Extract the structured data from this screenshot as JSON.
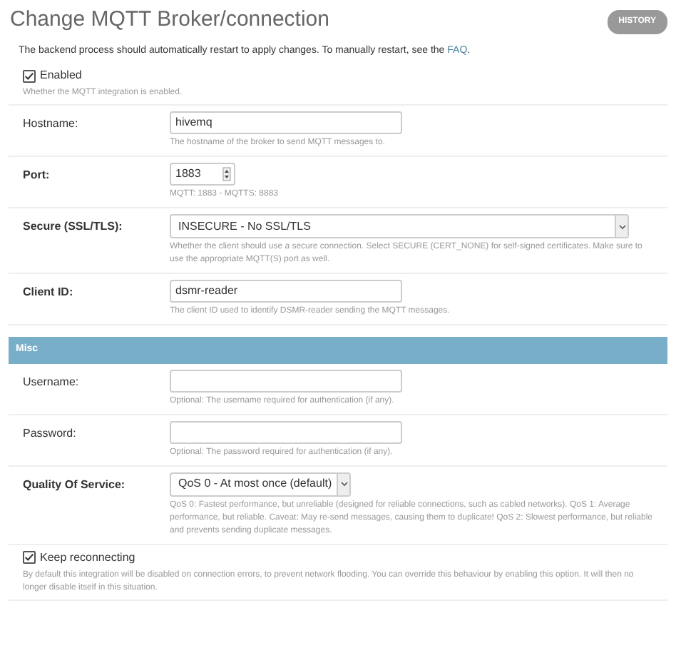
{
  "title": "Change MQTT Broker/connection",
  "history_button": "HISTORY",
  "intro": {
    "text": "The backend process should automatically restart to apply changes. To manually restart, see the",
    "link": "FAQ",
    "after": "."
  },
  "fieldsets": [
    {
      "fields": [
        {
          "kind": "checkbox",
          "label": "Enabled",
          "checked": true,
          "help": "Whether the MQTT integration is enabled."
        },
        {
          "kind": "text",
          "label": "Hostname:",
          "required": false,
          "value": "hivemq",
          "help": "The hostname of the broker to send MQTT messages to."
        },
        {
          "kind": "number",
          "label": "Port:",
          "required": true,
          "value": "1883",
          "help": "MQTT: 1883 - MQTTS: 8883"
        },
        {
          "kind": "select",
          "label": "Secure (SSL/TLS):",
          "required": true,
          "value": "INSECURE - No SSL/TLS",
          "wide": true,
          "help": "Whether the client should use a secure connection. Select SECURE (CERT_NONE) for self-signed certificates. Make sure to use the appropriate MQTT(S) port as well."
        },
        {
          "kind": "text",
          "label": "Client ID:",
          "required": true,
          "value": "dsmr-reader",
          "help": "The client ID used to identify DSMR-reader sending the MQTT messages."
        }
      ]
    },
    {
      "heading": "Misc",
      "fields": [
        {
          "kind": "text",
          "label": "Username:",
          "required": false,
          "help": "Optional: The username required for authentication (if any)."
        },
        {
          "kind": "text",
          "label": "Password:",
          "required": false,
          "help": "Optional: The password required for authentication (if any)."
        },
        {
          "kind": "select",
          "label": "Quality Of Service:",
          "required": true,
          "value": "QoS 0 - At most once (default)",
          "wide": false,
          "help": "QoS 0: Fastest performance, but unreliable (designed for reliable connections, such as cabled networks). QoS 1: Average performance, but reliable. Caveat: May re-send messages, causing them to duplicate! QoS 2: Slowest performance, but reliable and prevents sending duplicate messages."
        },
        {
          "kind": "checkbox",
          "label": "Keep reconnecting",
          "checked": true,
          "help": "By default this integration will be disabled on connection errors, to prevent network flooding. You can override this behaviour by enabling this option. It will then no longer disable itself in this situation."
        }
      ]
    }
  ]
}
